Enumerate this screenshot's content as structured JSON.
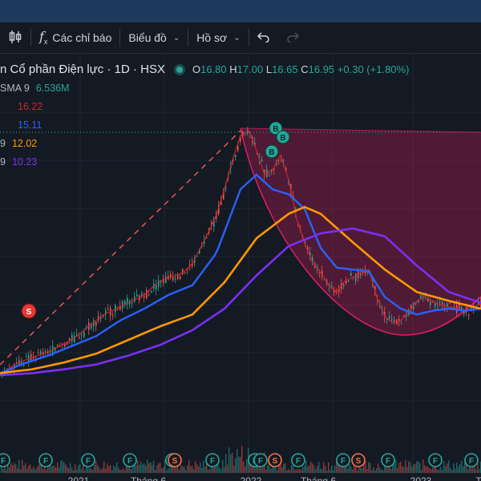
{
  "toolbar": {
    "indicators_label": "Các chỉ báo",
    "chart_label": "Biểu đồ",
    "profile_label": "Hồ sơ"
  },
  "legend": {
    "title": "n Cổ phần Điện lực · 1D · HSX",
    "open_label": "O",
    "open": "16.80",
    "high_label": "H",
    "high": "17.00",
    "low_label": "L",
    "low": "16.65",
    "close_label": "C",
    "close": "16.95",
    "change": "+0.30 (+1.80%)",
    "volume_sma_label": "SMA 9",
    "volume_sma_value": "6.536M",
    "ind1_value": "16.22",
    "ind2_value": "15.11",
    "ind3_label": "9",
    "ind3_value": "12.02",
    "ind4_label": "9",
    "ind4_value": "10.23"
  },
  "colors": {
    "up": "#26a69a",
    "down": "#ef5350",
    "ma_fast": "#c62828",
    "ma_blue": "#2962ff",
    "ma_orange": "#ff9800",
    "ma_purple": "#7b2ff7",
    "pattern": "#e91e63",
    "trend_dashed": "#ef5350"
  },
  "chart_data": {
    "type": "line",
    "title": "n Cổ phần Điện lực · 1D · HSX",
    "x_tick_labels": [
      "2021",
      "Tháng 6",
      "2022",
      "Tháng 6",
      "2023",
      "T"
    ],
    "series": [
      {
        "x": [
          0,
          10,
          20,
          30,
          40,
          50,
          60,
          70,
          80,
          90,
          100,
          110,
          120,
          130,
          140,
          150,
          160,
          170,
          180,
          190,
          200,
          210,
          220,
          230,
          240,
          250,
          260,
          270,
          280,
          290,
          300,
          310,
          320,
          330,
          340,
          350,
          360,
          370,
          380,
          390,
          400,
          410,
          420,
          430,
          440,
          450,
          460,
          470,
          480,
          490,
          500,
          510,
          520,
          530,
          540,
          550,
          560,
          570,
          580,
          590,
          600
        ],
        "values": [
          5.0,
          5.6,
          6.2,
          6.5,
          6.8,
          7.1,
          7.4,
          7.8,
          8.2,
          8.7,
          9.2,
          10.0,
          10.6,
          11.2,
          11.6,
          12.0,
          12.4,
          12.8,
          13.2,
          14.0,
          14.6,
          15.0,
          15.2,
          15.6,
          16.4,
          18.0,
          19.6,
          21.4,
          24.0,
          27.0,
          29.5,
          30.0,
          28.0,
          25.5,
          26.0,
          27.5,
          25.0,
          21.0,
          18.5,
          16.5,
          15.5,
          14.2,
          13.5,
          14.6,
          15.0,
          15.4,
          15.8,
          13.0,
          11.0,
          10.4,
          10.6,
          11.5,
          12.6,
          13.0,
          12.5,
          12.2,
          12.0,
          11.8,
          11.5,
          11.8,
          12.3
        ]
      },
      {
        "x": [
          0,
          30,
          60,
          90,
          120,
          150,
          180,
          210,
          240,
          270,
          300,
          320,
          340,
          360,
          380,
          400,
          420,
          440,
          460,
          480,
          500,
          520,
          540,
          560,
          580,
          600
        ],
        "values": [
          5.2,
          6.2,
          7.0,
          8.0,
          9.0,
          10.6,
          11.8,
          13.2,
          14.2,
          17.5,
          24.0,
          25.5,
          24.0,
          23.5,
          22.0,
          18.0,
          16.0,
          15.8,
          15.6,
          13.0,
          11.8,
          11.2,
          11.6,
          11.8,
          11.6,
          11.8
        ]
      },
      {
        "x": [
          0,
          40,
          80,
          120,
          160,
          200,
          240,
          280,
          320,
          360,
          380,
          400,
          440,
          480,
          520,
          560,
          600
        ],
        "values": [
          5.2,
          5.6,
          6.3,
          7.2,
          8.6,
          10.0,
          11.2,
          14.5,
          19.0,
          21.5,
          22.2,
          21.5,
          18.6,
          15.8,
          13.5,
          12.6,
          11.8
        ]
      },
      {
        "x": [
          0,
          40,
          80,
          120,
          160,
          200,
          240,
          280,
          320,
          360,
          400,
          440,
          480,
          520,
          560,
          600
        ],
        "values": [
          5.0,
          5.2,
          5.6,
          6.1,
          7.0,
          8.1,
          9.6,
          11.8,
          15.2,
          18.2,
          19.5,
          20.0,
          19.2,
          16.2,
          13.5,
          12.4
        ]
      }
    ]
  }
}
